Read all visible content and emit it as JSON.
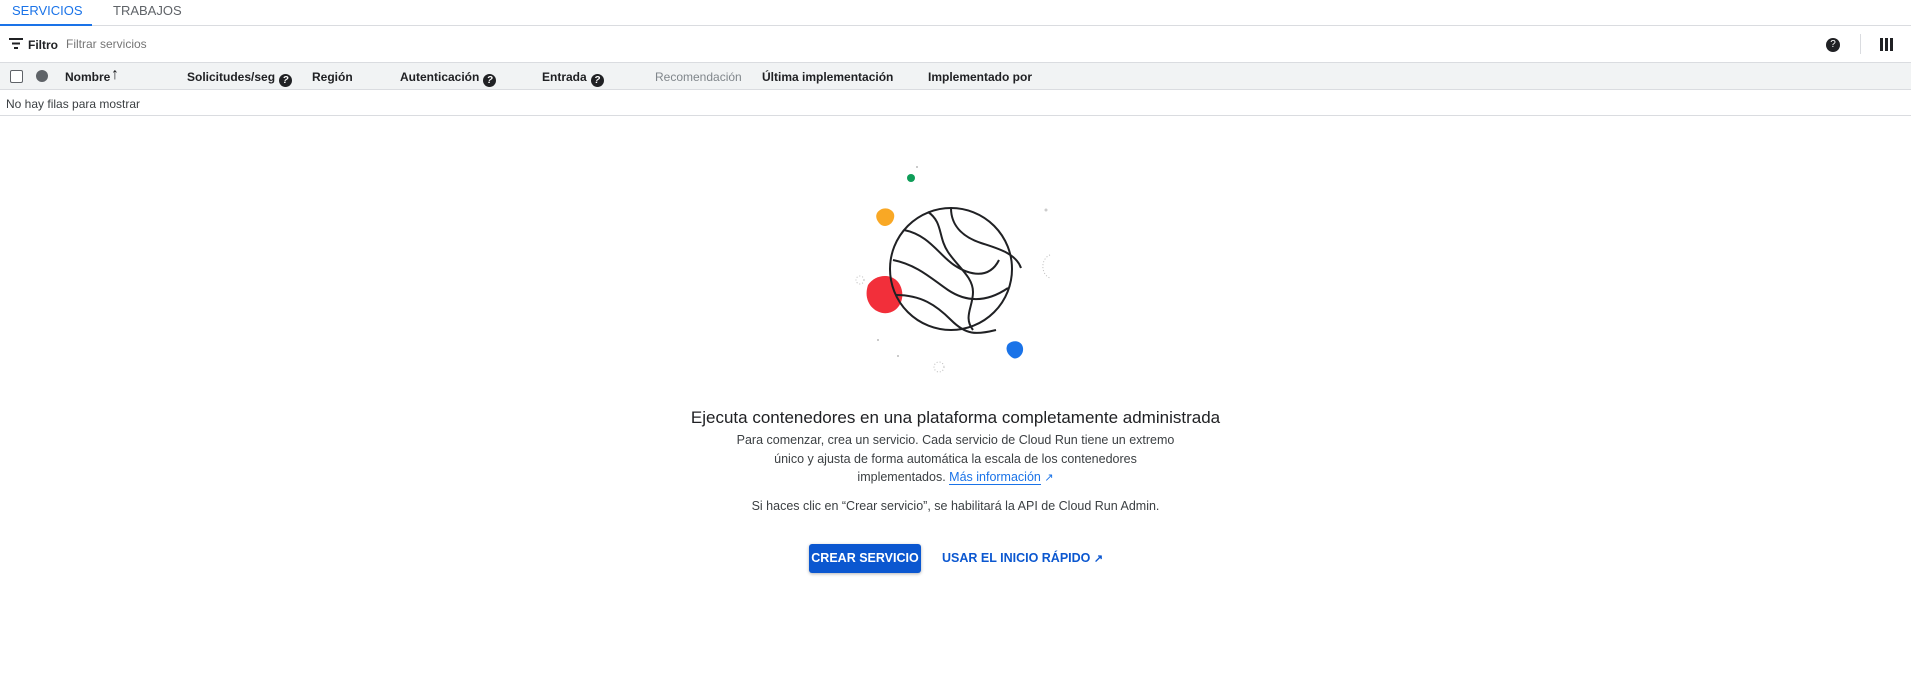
{
  "tabs": [
    {
      "label": "SERVICIOS",
      "active": true
    },
    {
      "label": "TRABAJOS",
      "active": false
    }
  ],
  "filter": {
    "label": "Filtro",
    "placeholder": "Filtrar servicios"
  },
  "columns": {
    "name": "Nombre",
    "requests": "Solicitudes/seg",
    "region": "Región",
    "auth": "Autenticación",
    "ingress": "Entrada",
    "recommendation": "Recomendación",
    "last_deploy": "Última implementación",
    "deployed_by": "Implementado por"
  },
  "empty_rows": "No hay filas para mostrar",
  "empty_state": {
    "title": "Ejecuta contenedores en una plataforma completamente administrada",
    "line1": "Para comenzar, crea un servicio. Cada servicio de Cloud Run tiene un extremo",
    "line2": "único y ajusta de forma automática la escala de los contenedores",
    "line3": "implementados.",
    "link": "Más información",
    "note": "Si haces clic en “Crear servicio”, se habilitará la API de Cloud Run Admin.",
    "primary_button": "CREAR SERVICIO",
    "secondary_button": "USAR EL INICIO RÁPIDO"
  },
  "colors": {
    "accent": "#1a73e8",
    "button": "#0b57d0"
  }
}
